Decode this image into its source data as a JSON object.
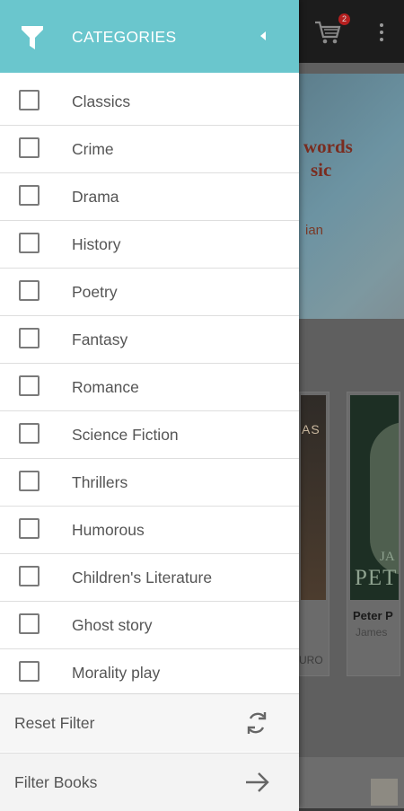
{
  "drawer": {
    "title": "CATEGORIES",
    "header_color": "#6ac6cd",
    "categories": [
      {
        "label": "Classics",
        "checked": false
      },
      {
        "label": "Crime",
        "checked": false
      },
      {
        "label": "Drama",
        "checked": false
      },
      {
        "label": "History",
        "checked": false
      },
      {
        "label": "Poetry",
        "checked": false
      },
      {
        "label": "Fantasy",
        "checked": false
      },
      {
        "label": "Romance",
        "checked": false
      },
      {
        "label": "Science Fiction",
        "checked": false
      },
      {
        "label": "Thrillers",
        "checked": false
      },
      {
        "label": "Humorous",
        "checked": false
      },
      {
        "label": "Children's Literature",
        "checked": false
      },
      {
        "label": "Ghost story",
        "checked": false
      },
      {
        "label": "Morality play",
        "checked": false
      }
    ],
    "reset_label": "Reset Filter",
    "filter_label": "Filter Books"
  },
  "background": {
    "cart_count": "2",
    "banner_title_lines": [
      "words",
      "sic"
    ],
    "banner_subtitle": "ian",
    "book1_cover_text": "AS",
    "book1_price": "URO",
    "book2_cover_small": "JA",
    "book2_cover_text": "PET",
    "book2_title": "Peter P",
    "book2_author": "James"
  }
}
